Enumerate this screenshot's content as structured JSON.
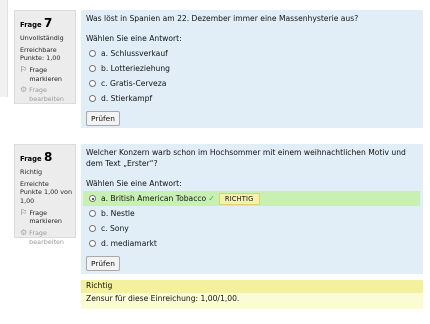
{
  "q7": {
    "label": "Frage",
    "number": "7",
    "state": "Unvollständig",
    "grade": "Erreichbare Punkte: 1,00",
    "flag_label": "Frage markieren",
    "edit_label": "Frage bearbeiten",
    "question": "Was löst in Spanien am 22. Dezember immer eine Massenhysterie aus?",
    "prompt": "Wählen Sie eine Antwort:",
    "options": [
      "a. Schlussverkauf",
      "b. Lotterieziehung",
      "c. Gratis-Cerveza",
      "d. Stierkampf"
    ],
    "check_label": "Prüfen"
  },
  "q8": {
    "label": "Frage",
    "number": "8",
    "state": "Richtig",
    "grade": "Erreichte Punkte 1,00 von 1,00",
    "flag_label": "Frage markieren",
    "edit_label": "Frage bearbeiten",
    "question": "Welcher Konzern warb schon im Hochsommer mit einem weihnachtlichen Motiv und dem Text „Erster“?",
    "prompt": "Wählen Sie eine Antwort:",
    "options": [
      "a. British American Tobacco",
      "b. Nestle",
      "c. Sony",
      "d. mediamarkt"
    ],
    "selected_index": 0,
    "result_badge": "RICHTIG",
    "check_label": "Prüfen",
    "feedback_title": "Richtig",
    "feedback_grade": "Zensur für diese Einreichung: 1,00/1,00."
  },
  "colors": {
    "question_bg": "#e1eef8",
    "info_bg": "#ececec",
    "correct_bg": "#c9f0b4",
    "feedback_bg": "#fcfcd4",
    "feedback_header_bg": "#f3f09e"
  },
  "icons": {
    "flag": "flag-icon",
    "edit": "gear-icon",
    "correct": "checkmark-icon"
  }
}
